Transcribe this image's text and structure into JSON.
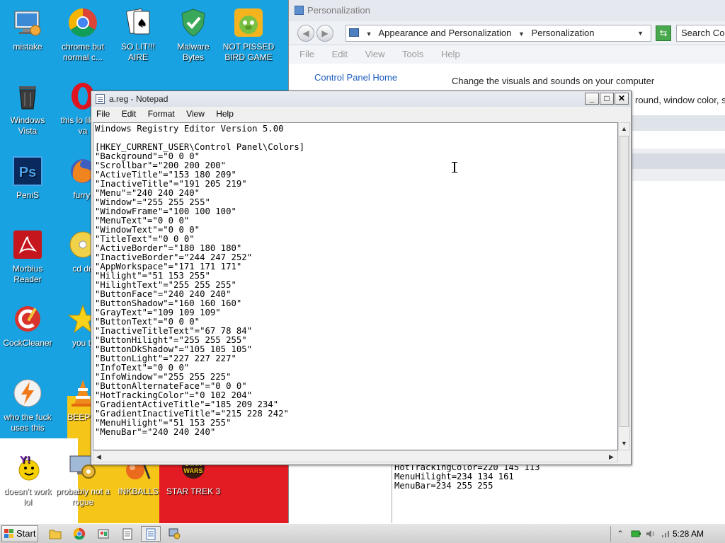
{
  "desktop": {
    "icons": [
      {
        "label": "mistake",
        "icon": "computer-icon"
      },
      {
        "label": "chrome but normal c...",
        "icon": "chrome-icon"
      },
      {
        "label": "SO LIT!!! AIRE",
        "icon": "solitaire-icon"
      },
      {
        "label": "Malware Bytes",
        "icon": "shield-check-icon"
      },
      {
        "label": "NOT PISSED BIRD GAME",
        "icon": "bird-game-icon"
      },
      {
        "label": "Windows Vista",
        "icon": "recycle-bin-icon"
      },
      {
        "label": "this lo like a va",
        "icon": "opera-icon"
      },
      {
        "label": "PeniS",
        "icon": "photoshop-icon"
      },
      {
        "label": "furryf",
        "icon": "firefox-icon"
      },
      {
        "label": "Morbius Reader",
        "icon": "pdf-reader-icon"
      },
      {
        "label": "cd dri",
        "icon": "cd-icon"
      },
      {
        "label": "CockCleaner",
        "icon": "ccleaner-icon"
      },
      {
        "label": "you tr",
        "icon": "star-icon"
      },
      {
        "label": "who the fuck uses this",
        "icon": "lightning-icon"
      },
      {
        "label": "BEEP B",
        "icon": "vlc-cone-icon"
      },
      {
        "label": "doesn't work lol",
        "icon": "yahoo-messenger-icon"
      },
      {
        "label": "probably not a rogue",
        "icon": "gear-monitor-icon"
      },
      {
        "label": "INKBALLS",
        "icon": "inkball-icon"
      },
      {
        "label": "STAR TREK 3",
        "icon": "star-wars-icon"
      }
    ]
  },
  "personalization": {
    "title": "Personalization",
    "breadcrumb": [
      "Appearance and Personalization",
      "Personalization"
    ],
    "search_placeholder": "Search Con",
    "menu": [
      "File",
      "Edit",
      "View",
      "Tools",
      "Help"
    ],
    "sidebar_link": "Control Panel Home",
    "heading": "Change the visuals and sounds on your computer",
    "partial_text": "round, window color, s",
    "bottom_text": "HotTrackingColor=220 145 113\nMenuHilight=234 134 161\nMenuBar=234 255 255"
  },
  "notepad": {
    "title": "a.reg - Notepad",
    "menu": [
      "File",
      "Edit",
      "Format",
      "View",
      "Help"
    ],
    "content": "Windows Registry Editor Version 5.00\n\n[HKEY_CURRENT_USER\\Control Panel\\Colors]\n\"Background\"=\"0 0 0\"\n\"Scrollbar\"=\"200 200 200\"\n\"ActiveTitle\"=\"153 180 209\"\n\"InactiveTitle\"=\"191 205 219\"\n\"Menu\"=\"240 240 240\"\n\"Window\"=\"255 255 255\"\n\"WindowFrame\"=\"100 100 100\"\n\"MenuText\"=\"0 0 0\"\n\"WindowText\"=\"0 0 0\"\n\"TitleText\"=\"0 0 0\"\n\"ActiveBorder\"=\"180 180 180\"\n\"InactiveBorder\"=\"244 247 252\"\n\"AppWorkspace\"=\"171 171 171\"\n\"Hilight\"=\"51 153 255\"\n\"HilightText\"=\"255 255 255\"\n\"ButtonFace\"=\"240 240 240\"\n\"ButtonShadow\"=\"160 160 160\"\n\"GrayText\"=\"109 109 109\"\n\"ButtonText\"=\"0 0 0\"\n\"InactiveTitleText\"=\"67 78 84\"\n\"ButtonHilight\"=\"255 255 255\"\n\"ButtonDkShadow\"=\"105 105 105\"\n\"ButtonLight\"=\"227 227 227\"\n\"InfoText\"=\"0 0 0\"\n\"InfoWindow\"=\"255 255 225\"\n\"ButtonAlternateFace\"=\"0 0 0\"\n\"HotTrackingColor\"=\"0 102 204\"\n\"GradientActiveTitle\"=\"185 209 234\"\n\"GradientInactiveTitle\"=\"215 228 242\"\n\"MenuHilight\"=\"51 153 255\"\n\"MenuBar\"=\"240 240 240\""
  },
  "taskbar": {
    "start_label": "Start",
    "clock": "5:28 AM"
  },
  "colors": {
    "desktop_blue": "#19a2e2",
    "accent_red": "#e31b23",
    "accent_yellow": "#f5c518"
  }
}
